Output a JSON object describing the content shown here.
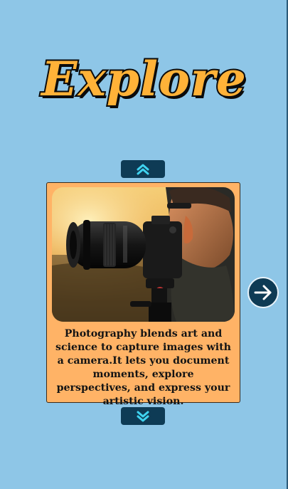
{
  "title": "Explore",
  "card": {
    "image_alt": "Photographer with a camera on a tripod at sunset",
    "caption": "Photography blends art and science to capture images with a camera.It lets you document moments, explore perspectives, and express your artistic vision."
  },
  "icons": {
    "up": "chevrons-up-icon",
    "down": "chevrons-down-icon",
    "next": "arrow-right-icon"
  },
  "colors": {
    "background": "#8ec6e7",
    "title_fill": "#ffb238",
    "card_fill": "#ffb366",
    "button_fill": "#0e3b55",
    "chevron": "#3fd3f0"
  }
}
